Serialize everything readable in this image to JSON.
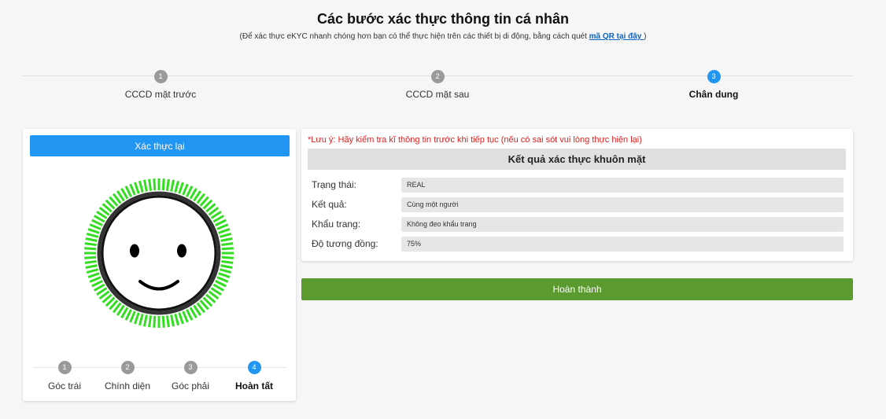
{
  "header": {
    "title": "Các bước xác thực thông tin cá nhân",
    "subtitle_text": "(Để xác thực eKYC nhanh chóng hơn bạn có thể thực hiện trên các thiết bị di động, bằng cách quét ",
    "subtitle_link": "mã QR tại đây ",
    "subtitle_end": ")"
  },
  "steps": [
    {
      "number": "1",
      "label": "CCCD mặt trước",
      "active": false
    },
    {
      "number": "2",
      "label": "CCCD mặt sau",
      "active": false
    },
    {
      "number": "3",
      "label": "Chân dung",
      "active": true
    }
  ],
  "capture": {
    "reverify_label": "Xác thực lại",
    "substeps": [
      {
        "number": "1",
        "label": "Góc trái",
        "active": false
      },
      {
        "number": "2",
        "label": "Chính diện",
        "active": false
      },
      {
        "number": "3",
        "label": "Góc phải",
        "active": false
      },
      {
        "number": "4",
        "label": "Hoàn tất",
        "active": true
      }
    ],
    "ring_color": "#33dd22"
  },
  "result": {
    "note": "*Lưu ý: Hãy kiểm tra kĩ thông tin trước khi tiếp tục (nếu có sai sót vui lòng thực hiện lại)",
    "header": "Kết quả xác thực khuôn mặt",
    "rows": [
      {
        "key": "Trạng thái:",
        "value": "REAL"
      },
      {
        "key": "Kết quả:",
        "value": "Cùng một người"
      },
      {
        "key": "Khẩu trang:",
        "value": "Không đeo khẩu trang"
      },
      {
        "key": "Độ tương đồng:",
        "value": "75%"
      }
    ]
  },
  "done_label": "Hoàn thành",
  "colors": {
    "primary": "#2196f3",
    "success": "#5a9a2f",
    "warning": "#e02020",
    "inactive": "#9a9a9a"
  }
}
